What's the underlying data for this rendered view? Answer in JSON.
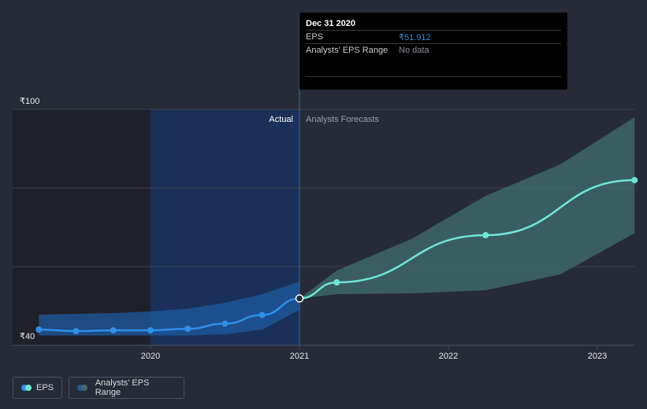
{
  "tooltip": {
    "date": "Dec 31 2020",
    "rows": [
      {
        "label": "EPS",
        "value": "₹51.912"
      },
      {
        "label": "Analysts' EPS Range",
        "value": "No data"
      }
    ]
  },
  "labels": {
    "actual": "Actual",
    "forecast": "Analysts Forecasts"
  },
  "legend": {
    "eps": "EPS",
    "range": "Analysts' EPS Range"
  },
  "colors": {
    "background": "#262b37",
    "eps_line": "#2f8fe8",
    "forecast_line": "#6ee7d6",
    "forecast_band": "#3f6a6c",
    "actual_band": "#1d5aa0",
    "highlight_region": "#1a3058",
    "past_region": "#1e2129"
  },
  "chart_data": {
    "type": "line",
    "x_unit": "year",
    "xlim": [
      2019.15,
      2023.25
    ],
    "ylim": [
      40,
      100
    ],
    "y_ticks": [
      {
        "value": 100,
        "label": "₹100"
      },
      {
        "value": 40,
        "label": "₹40"
      }
    ],
    "x_ticks": [
      {
        "value": 2020,
        "label": "2020"
      },
      {
        "value": 2021,
        "label": "2021"
      },
      {
        "value": 2022,
        "label": "2022"
      },
      {
        "value": 2023,
        "label": "2023"
      }
    ],
    "divider_x": 2021,
    "series": [
      {
        "name": "EPS",
        "kind": "actual",
        "points": [
          [
            2019.25,
            44.0
          ],
          [
            2019.5,
            43.6
          ],
          [
            2019.75,
            43.8
          ],
          [
            2020.0,
            43.8
          ],
          [
            2020.25,
            44.2
          ],
          [
            2020.5,
            45.5
          ],
          [
            2020.75,
            47.7
          ],
          [
            2021.0,
            51.912
          ]
        ]
      },
      {
        "name": "EPS",
        "kind": "forecast",
        "points": [
          [
            2021.0,
            51.912
          ],
          [
            2021.25,
            56.0
          ],
          [
            2022.25,
            68.0
          ],
          [
            2023.25,
            82.0
          ]
        ]
      }
    ],
    "ranges": [
      {
        "name": "Analysts' EPS Range",
        "kind": "actual",
        "x": [
          2019.25,
          2019.5,
          2019.75,
          2020.0,
          2020.25,
          2020.5,
          2020.75,
          2021.0
        ],
        "low": [
          42.5,
          42.5,
          42.5,
          42.5,
          42.5,
          42.8,
          44.0,
          49.0
        ],
        "high": [
          47.8,
          48.0,
          48.2,
          48.6,
          49.3,
          50.8,
          53.0,
          56.2
        ]
      },
      {
        "name": "Analysts' EPS Range",
        "kind": "forecast",
        "x": [
          2021.0,
          2021.25,
          2021.75,
          2022.25,
          2022.75,
          2023.25
        ],
        "low": [
          51.9,
          53.0,
          53.2,
          54.0,
          58.0,
          68.5
        ],
        "high": [
          51.9,
          59.0,
          67.0,
          78.0,
          86.0,
          98.0
        ]
      }
    ],
    "markers": [
      {
        "series": "EPS",
        "x": 2021.0,
        "y": 51.912,
        "hollow": true
      }
    ]
  }
}
